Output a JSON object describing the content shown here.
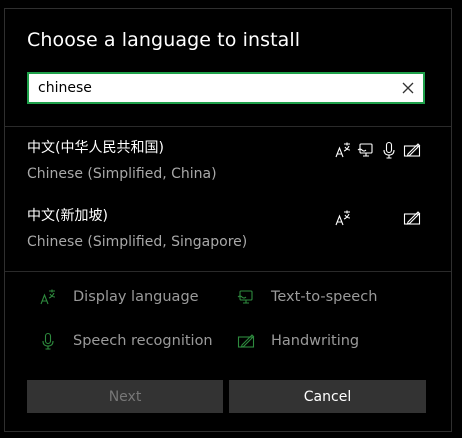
{
  "dialog": {
    "title": "Choose a language to install"
  },
  "search": {
    "value": "chinese",
    "placeholder": ""
  },
  "languages": [
    {
      "native": "中文(中华人民共和国)",
      "english": "Chinese (Simplified, China)",
      "features": [
        "display-language",
        "text-to-speech",
        "speech-recognition",
        "handwriting"
      ]
    },
    {
      "native": "中文(新加坡)",
      "english": "Chinese (Simplified, Singapore)",
      "features": [
        "display-language",
        "handwriting"
      ]
    }
  ],
  "legend": {
    "display_language": "Display language",
    "text_to_speech": "Text-to-speech",
    "speech_recognition": "Speech recognition",
    "handwriting": "Handwriting"
  },
  "buttons": {
    "next": "Next",
    "cancel": "Cancel"
  },
  "colors": {
    "accent": "#1ea04a",
    "legend_icon": "#2e8b3e"
  }
}
